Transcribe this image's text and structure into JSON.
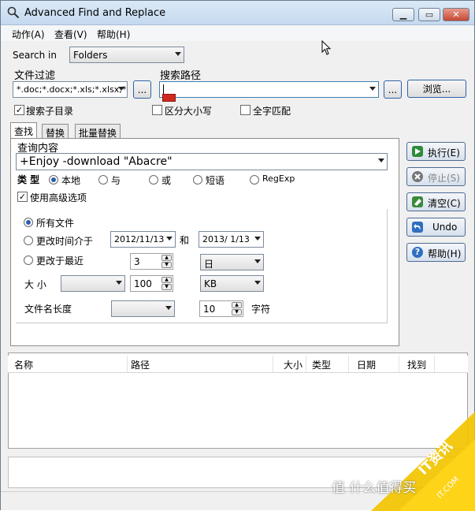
{
  "window": {
    "title": "Advanced Find and Replace"
  },
  "menu": [
    "动作(A)",
    "查看(V)",
    "帮助(H)"
  ],
  "search_in": {
    "label": "Search in",
    "value": "Folders"
  },
  "file_filter": {
    "label": "文件过滤",
    "value": "*.doc;*.docx;*.xls;*.xlsx;*.h"
  },
  "search_path": {
    "label": "搜索路径",
    "value": ""
  },
  "browse_button": "...",
  "browse_label": "浏览...",
  "options": {
    "search_subdirs": "搜索子目录",
    "match_case": "区分大小写",
    "whole_word": "全字匹配"
  },
  "tabs": [
    "查找",
    "替换",
    "批量替换"
  ],
  "query": {
    "label": "查询内容",
    "value": "+Enjoy -download \"Abacre\""
  },
  "type": {
    "label": "类 型",
    "options": [
      "本地",
      "与",
      "或",
      "短语",
      "RegExp"
    ],
    "selected": "本地"
  },
  "advanced": {
    "label": "使用高级选项",
    "all_files": "所有文件",
    "modified_between": "更改时间介于",
    "date_from": "2012/11/13",
    "and_label": "和",
    "date_to": "2013/ 1/13",
    "modified_recent": "更改于最近",
    "recent_value": "3",
    "recent_unit": "日",
    "size_label": "大 小",
    "size_value": "100",
    "size_unit": "KB",
    "name_len_label": "文件名长度",
    "name_len_value": "10",
    "name_len_unit": "字符"
  },
  "side_buttons": {
    "execute": "执行(E)",
    "stop": "停止(S)",
    "clear": "清空(C)",
    "undo": "Undo",
    "help": "帮助(H)"
  },
  "results_columns": [
    "名称",
    "路径",
    "大小",
    "类型",
    "日期",
    "找到"
  ],
  "watermark": {
    "line1": "值 什么值得买",
    "line2": "IT资讯",
    "line3": "IT.COM"
  },
  "colors": {
    "accent": "#2a5db0",
    "titlebar": "#c4d9ef",
    "close": "#c74733",
    "watermark": "#f2c400"
  }
}
